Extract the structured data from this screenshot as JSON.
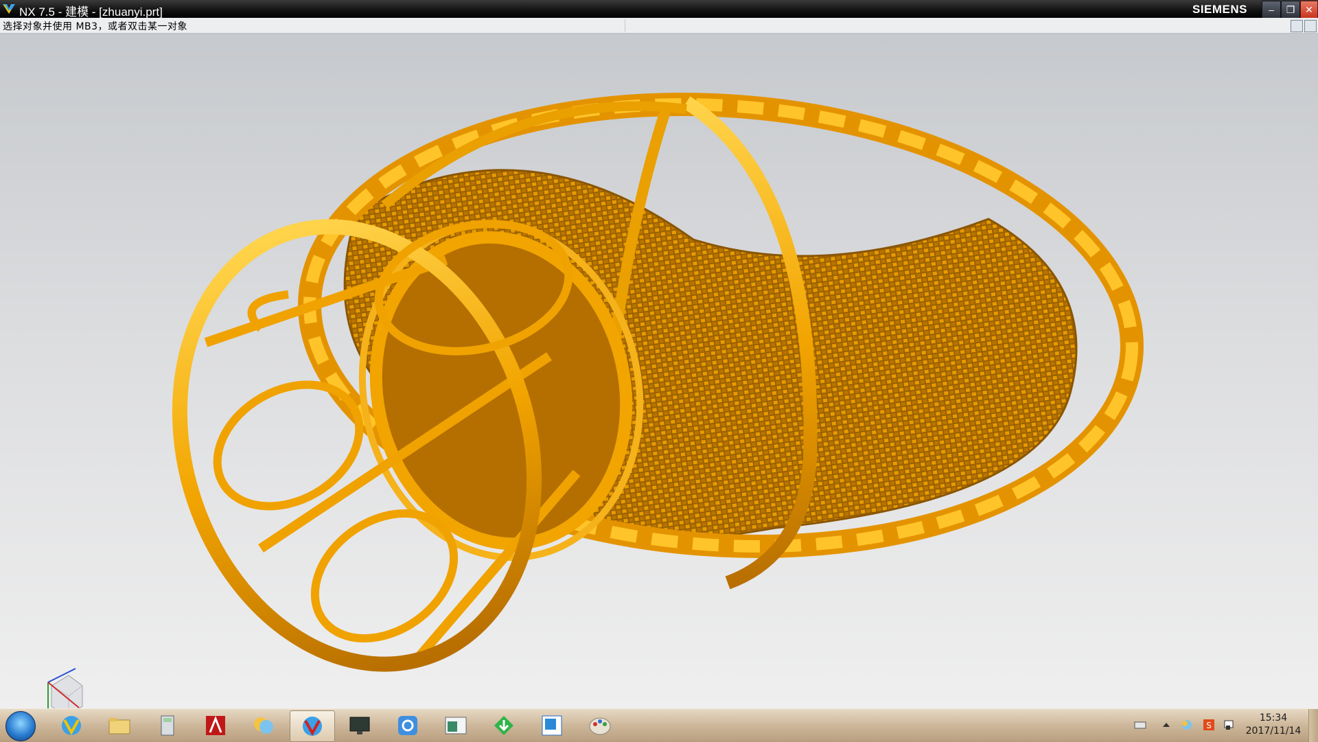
{
  "window": {
    "title": "NX 7.5 - 建模 - [zhuanyi.prt]",
    "brand": "SIEMENS",
    "buttons": {
      "minimize": "–",
      "restore": "❐",
      "close": "✕"
    }
  },
  "cue_line": {
    "text": "选择对象并使用 MB3，或者双击某一对象"
  },
  "graphics": {
    "model_color": "#f2a400",
    "model_shadow": "#c27800",
    "weave_color": "#d08a00",
    "background_top": "#c6c9cd",
    "background_bottom": "#efefef",
    "triad_axes": [
      "Z",
      "Y",
      "X"
    ]
  },
  "taskbar": {
    "start_icon": "windows-start-icon",
    "items": [
      {
        "name": "nx-icon",
        "active": false
      },
      {
        "name": "folder-icon",
        "active": false
      },
      {
        "name": "calculator-icon",
        "active": false
      },
      {
        "name": "autocad-icon",
        "active": false
      },
      {
        "name": "messenger-icon",
        "active": false
      },
      {
        "name": "nx-icon",
        "active": true
      },
      {
        "name": "monitor-icon",
        "active": false
      },
      {
        "name": "qq-icon",
        "active": false
      },
      {
        "name": "window-app-icon",
        "active": false
      },
      {
        "name": "download-icon",
        "active": false
      },
      {
        "name": "blue-window-icon",
        "active": false
      },
      {
        "name": "paint-icon",
        "active": false
      }
    ],
    "tray_icons": [
      "keyboard-icon",
      "up-arrow-icon",
      "network-icon",
      "sogou-icon",
      "flag-icon"
    ],
    "clock": {
      "time": "15:34",
      "date": "2017/11/14"
    }
  }
}
